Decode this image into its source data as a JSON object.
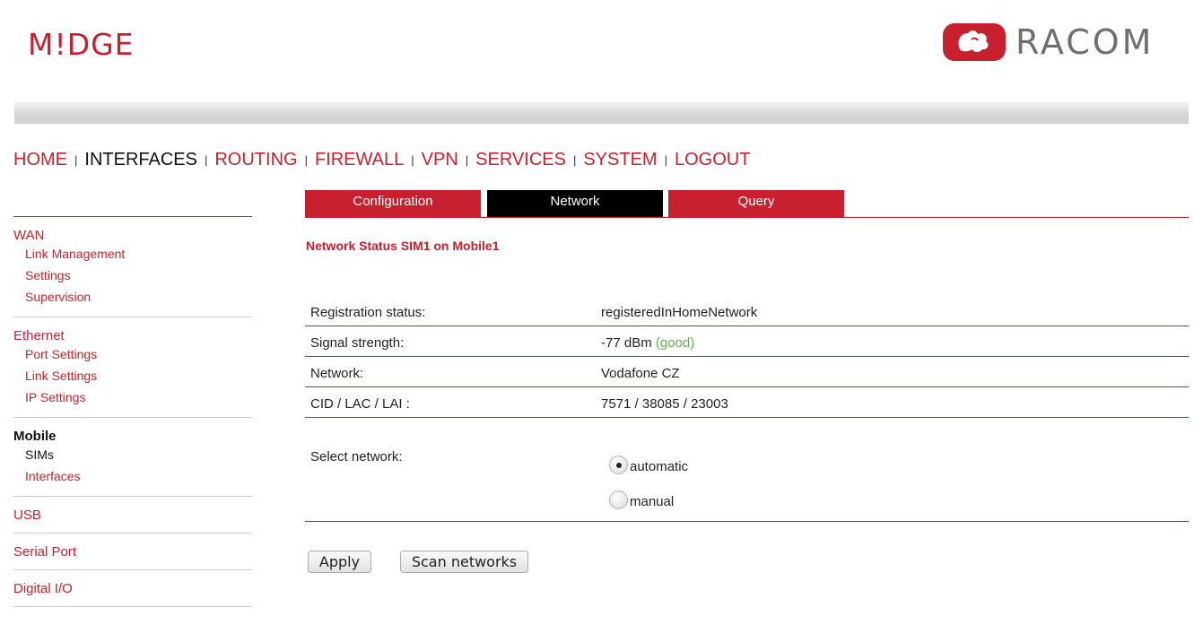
{
  "header": {
    "logo_left": "M!DGE",
    "logo_right": "RACOM",
    "brand_color": "#c8202e"
  },
  "main_nav": [
    {
      "label": "HOME",
      "active": false
    },
    {
      "label": "INTERFACES",
      "active": true
    },
    {
      "label": "ROUTING",
      "active": false
    },
    {
      "label": "FIREWALL",
      "active": false
    },
    {
      "label": "VPN",
      "active": false
    },
    {
      "label": "SERVICES",
      "active": false
    },
    {
      "label": "SYSTEM",
      "active": false
    },
    {
      "label": "LOGOUT",
      "active": false
    }
  ],
  "nav_separator": "|",
  "tabs": [
    {
      "label": "Configuration",
      "active": false
    },
    {
      "label": "Network",
      "active": true
    },
    {
      "label": "Query",
      "active": false
    }
  ],
  "sidebar": {
    "sections": [
      {
        "label": "WAN",
        "active": false,
        "items": [
          {
            "label": "Link Management",
            "active": false
          },
          {
            "label": "Settings",
            "active": false
          },
          {
            "label": "Supervision",
            "active": false
          }
        ]
      },
      {
        "label": "Ethernet",
        "active": false,
        "items": [
          {
            "label": "Port Settings",
            "active": false
          },
          {
            "label": "Link Settings",
            "active": false
          },
          {
            "label": "IP Settings",
            "active": false
          }
        ]
      },
      {
        "label": "Mobile",
        "active": true,
        "items": [
          {
            "label": "SIMs",
            "active": true
          },
          {
            "label": "Interfaces",
            "active": false
          }
        ]
      },
      {
        "label": "USB",
        "active": false,
        "items": []
      },
      {
        "label": "Serial Port",
        "active": false,
        "items": []
      },
      {
        "label": "Digital I/O",
        "active": false,
        "items": []
      }
    ]
  },
  "content": {
    "title": "Network Status SIM1 on Mobile1",
    "rows": [
      {
        "label": "Registration status:",
        "value": "registeredInHomeNetwork",
        "note": ""
      },
      {
        "label": "Signal strength:",
        "value": "-77 dBm",
        "note": "(good)"
      },
      {
        "label": "Network:",
        "value": "Vodafone CZ",
        "note": ""
      },
      {
        "label": "CID / LAC / LAI :",
        "value": "7571 / 38085 / 23003",
        "note": ""
      }
    ],
    "select_network": {
      "label": "Select network:",
      "options": [
        {
          "label": "automatic",
          "selected": true
        },
        {
          "label": "manual",
          "selected": false
        }
      ]
    },
    "buttons": {
      "apply": "Apply",
      "scan": "Scan networks"
    }
  }
}
